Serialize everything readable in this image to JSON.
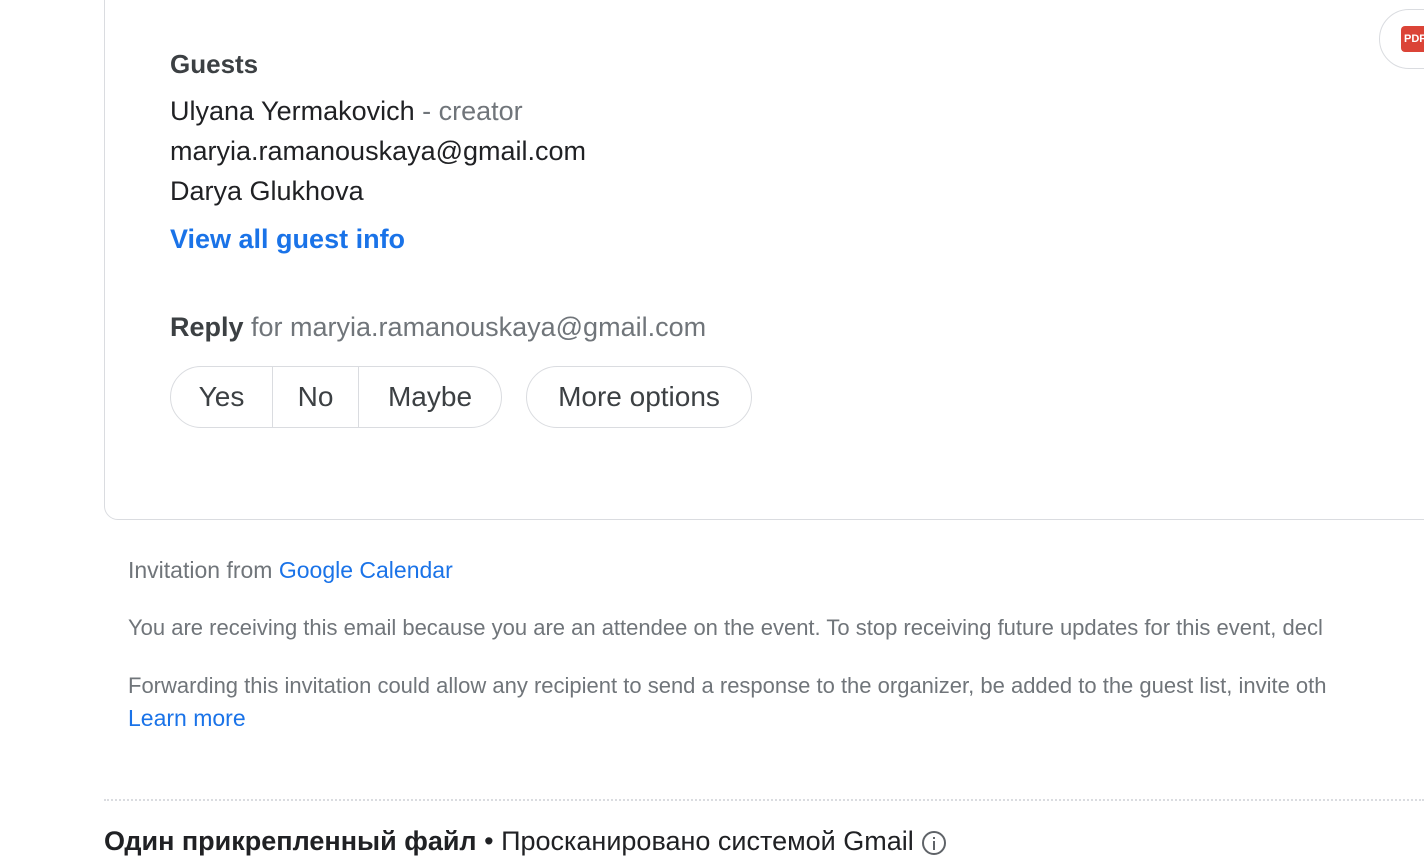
{
  "event": {
    "guests_title": "Guests",
    "guests": [
      {
        "name": "Ulyana Yermakovich",
        "role": " - creator"
      },
      {
        "name": "maryia.ramanouskaya@gmail.com",
        "role": ""
      },
      {
        "name": "Darya Glukhova",
        "role": ""
      }
    ],
    "view_all_label": "View all guest info",
    "reply_label": "Reply",
    "reply_for": " for maryia.ramanouskaya@gmail.com",
    "rsvp": {
      "yes": "Yes",
      "no": "No",
      "maybe": "Maybe"
    },
    "more_options": "More options",
    "attachment_icon": "pdf-icon",
    "attachment_badge": "PDF"
  },
  "footer": {
    "invitation_prefix": "Invitation from ",
    "invitation_link": "Google Calendar",
    "receiving_text": "You are receiving this email because you are an attendee on the event. To stop receiving future updates for this event, decl",
    "forwarding_text": "Forwarding this invitation could allow any recipient to send a response to the organizer, be added to the guest list, invite oth",
    "learn_more": "Learn more"
  },
  "attachments": {
    "title": "Один прикрепленный файл",
    "separator": " • ",
    "scan_text": "Просканировано системой Gmail",
    "info_icon": "info-icon"
  },
  "colors": {
    "link": "#1a73e8",
    "muted": "#70757a",
    "border": "#dadce0",
    "pdf_red": "#db4437"
  }
}
